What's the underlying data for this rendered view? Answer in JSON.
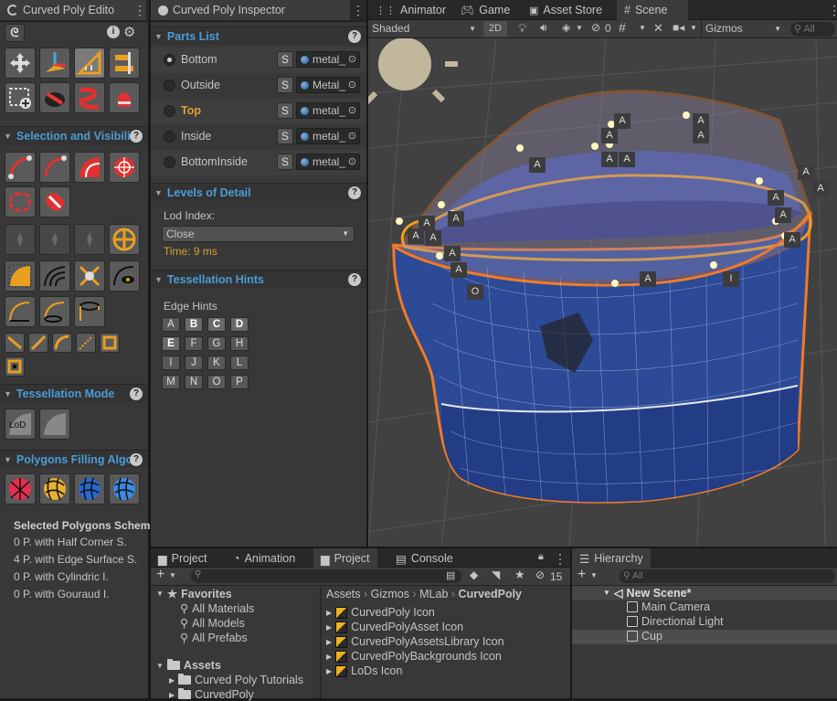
{
  "tool_panel": {
    "title": "Curved Poly Edito",
    "sections": {
      "selection": "Selection and Visibility",
      "tessellation_mode": "Tessellation Mode",
      "polygons_filling": "Polygons Filling Algor"
    },
    "selected_schemes": {
      "title": "Selected Polygons Schem",
      "lines": [
        "0 P. with Half Corner S.",
        "4 P. with Edge Surface S.",
        "0 P. with Cylindric I.",
        "0 P. with Gouraud I."
      ]
    }
  },
  "inspector": {
    "tab": "Curved Poly Inspector",
    "parts_header": "Parts List",
    "parts": [
      {
        "name": "Bottom",
        "material": "metal_",
        "selected": true
      },
      {
        "name": "Outside",
        "material": "Metal_",
        "selected": false
      },
      {
        "name": "Top",
        "material": "metal_",
        "selected": false,
        "highlighted": true
      },
      {
        "name": "Inside",
        "material": "metal_",
        "selected": false
      },
      {
        "name": "BottomInside",
        "material": "metal_",
        "selected": false
      }
    ],
    "s_label": "S",
    "lod_header": "Levels of Detail",
    "lod_label": "Lod Index:",
    "lod_value": "Close",
    "time_text": "Time: 9 ms",
    "tess_header": "Tessellation Hints",
    "edge_hints_label": "Edge Hints",
    "hint_rows": [
      [
        "A",
        "B",
        "C",
        "D"
      ],
      [
        "E",
        "F",
        "G",
        "H"
      ],
      [
        "I",
        "J",
        "K",
        "L"
      ],
      [
        "M",
        "N",
        "O",
        "P"
      ]
    ],
    "hints_active": [
      "B",
      "C",
      "D",
      "E"
    ]
  },
  "scene_tabs": {
    "animator": "Animator",
    "game": "Game",
    "asset_store": "Asset Store",
    "scene": "Scene"
  },
  "scene_toolbar": {
    "shading": "Shaded",
    "mode_2d": "2D",
    "hidden_count": "0",
    "gizmos": "Gizmos",
    "search_placeholder": "All"
  },
  "scene_labels": {
    "a": "A",
    "o": "O",
    "i": "I"
  },
  "project": {
    "tabs": [
      "Project",
      "Animation",
      "Project",
      "Console"
    ],
    "hidden_count": "15",
    "favorites": {
      "label": "Favorites",
      "items": [
        "All Materials",
        "All Models",
        "All Prefabs"
      ]
    },
    "assets": {
      "label": "Assets",
      "items": [
        "Curved Poly Tutorials",
        "CurvedPoly"
      ]
    },
    "breadcrumb": [
      "Assets",
      "Gizmos",
      "MLab",
      "CurvedPoly"
    ],
    "files": [
      "CurvedPoly Icon",
      "CurvedPolyAsset Icon",
      "CurvedPolyAssetsLibrary Icon",
      "CurvedPolyBackgrounds Icon",
      "LoDs Icon"
    ]
  },
  "hierarchy": {
    "tab": "Hierarchy",
    "search_placeholder": "All",
    "scene": "New Scene*",
    "items": [
      "Main Camera",
      "Directional Light",
      "Cup"
    ]
  },
  "colors": {
    "accent": "#4a9cd6",
    "orange_selection": "#f07a28",
    "editor_bg": "#383838",
    "panel_dark": "#282828"
  }
}
